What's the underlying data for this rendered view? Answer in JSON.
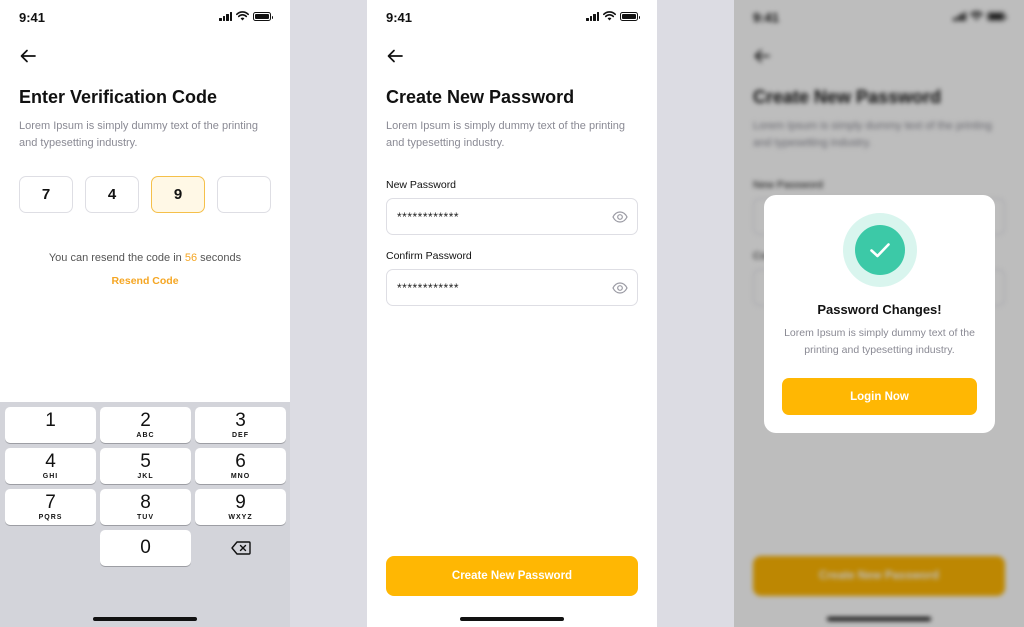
{
  "colors": {
    "accent": "#ffb703",
    "success": "#3cc9a7",
    "link": "#f5a623"
  },
  "status_bar": {
    "time": "9:41"
  },
  "verification": {
    "title": "Enter Verification Code",
    "subtitle": "Lorem Ipsum is simply dummy text of the printing and typesetting industry.",
    "code_digits": [
      "7",
      "4",
      "9",
      ""
    ],
    "active_digit_index": 2,
    "resend_prefix": "You can resend the code in",
    "resend_seconds": "56",
    "resend_suffix": "seconds",
    "resend_link": "Resend Code",
    "keypad": [
      {
        "num": "1",
        "letters": ""
      },
      {
        "num": "2",
        "letters": "ABC"
      },
      {
        "num": "3",
        "letters": "DEF"
      },
      {
        "num": "4",
        "letters": "GHI"
      },
      {
        "num": "5",
        "letters": "JKL"
      },
      {
        "num": "6",
        "letters": "MNO"
      },
      {
        "num": "7",
        "letters": "PQRS"
      },
      {
        "num": "8",
        "letters": "TUV"
      },
      {
        "num": "9",
        "letters": "WXYZ"
      },
      {
        "num": "0",
        "letters": ""
      }
    ],
    "backspace_icon": "backspace-icon"
  },
  "create_password": {
    "title": "Create New Password",
    "subtitle": "Lorem Ipsum is simply dummy text of the printing and typesetting industry.",
    "new_password_label": "New Password",
    "new_password_value": "************",
    "confirm_password_label": "Confirm Password",
    "confirm_password_value": "************",
    "eye_icon": "eye-icon",
    "submit_label": "Create New Password"
  },
  "success_modal": {
    "title": "Password Changes!",
    "text": "Lorem Ipsum is simply dummy text of the printing and typesetting industry.",
    "button_label": "Login Now",
    "icon": "check-icon"
  }
}
